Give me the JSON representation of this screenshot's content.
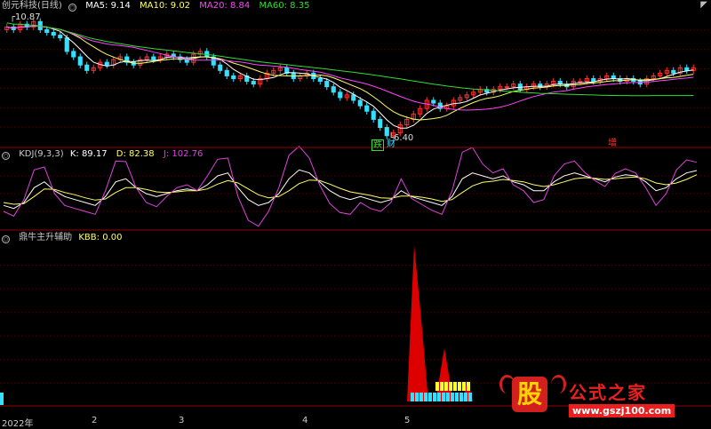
{
  "colors": {
    "ma5": "#ffffff",
    "ma10": "#ffff66",
    "ma20": "#ff44ff",
    "ma60": "#33dd33",
    "up": "#ff3333",
    "down": "#33e0ff",
    "divider": "#990000",
    "grid": "#550000",
    "k": "#ffffff",
    "d": "#ffff66",
    "j": "#dd44dd",
    "kbb_red": "#dd0000",
    "kbb_cyan": "#33e0ff",
    "kbb_yellow": "#ffff33"
  },
  "main_panel": {
    "title": "创元科技(日线)",
    "indicators": [
      {
        "label": "MA5: 9.14",
        "color": "#ffffff"
      },
      {
        "label": "MA10: 9.02",
        "color": "#ffff66"
      },
      {
        "label": "MA20: 8.84",
        "color": "#ff44ff"
      },
      {
        "label": "MA60: 8.35",
        "color": "#33dd33"
      }
    ],
    "high_mark": "10.87",
    "low_mark": "6.40",
    "tags": [
      {
        "text": "跌",
        "color": "#33dd33"
      },
      {
        "text": "财",
        "color": "#33e0ff"
      },
      {
        "text": "增",
        "color": "#ff3333"
      }
    ]
  },
  "kdj_panel": {
    "title": "KDJ(9,3,3)",
    "indicators": [
      {
        "label": "K: 89.17",
        "color": "#ffffff"
      },
      {
        "label": "D: 82.38",
        "color": "#ffff66"
      },
      {
        "label": "J: 102.76",
        "color": "#dd44dd"
      }
    ]
  },
  "kbb_panel": {
    "title": "鼎牛主升辅助",
    "indicators": [
      {
        "label": "KBB: 0.00",
        "color": "#ffff66"
      }
    ]
  },
  "time_axis": [
    "2022年",
    "2",
    "3",
    "4",
    "5"
  ],
  "watermark": {
    "badge": "股",
    "name": "公式之家",
    "url": "www.gszj100.com"
  },
  "chart_data": [
    {
      "type": "candlestick",
      "title": "创元科技(日线)",
      "series": [
        {
          "name": "MA5",
          "last": 9.14
        },
        {
          "name": "MA10",
          "last": 9.02
        },
        {
          "name": "MA20",
          "last": 8.84
        },
        {
          "name": "MA60",
          "last": 8.35
        }
      ],
      "annotations": [
        {
          "text": "10.87",
          "kind": "period-high"
        },
        {
          "text": "6.40",
          "kind": "period-low"
        }
      ],
      "close": [
        10.6,
        10.5,
        10.7,
        10.6,
        10.8,
        10.5,
        10.4,
        10.3,
        10.2,
        9.7,
        9.5,
        9.2,
        9.0,
        9.1,
        9.3,
        9.2,
        9.4,
        9.5,
        9.3,
        9.2,
        9.4,
        9.5,
        9.4,
        9.5,
        9.6,
        9.5,
        9.4,
        9.3,
        9.6,
        9.7,
        9.5,
        9.2,
        9.0,
        8.8,
        8.7,
        8.8,
        8.6,
        8.5,
        8.7,
        8.9,
        9.0,
        9.1,
        8.9,
        8.7,
        8.8,
        8.9,
        8.7,
        8.6,
        8.4,
        8.2,
        8.0,
        8.1,
        7.9,
        7.7,
        7.5,
        7.2,
        6.9,
        6.6,
        6.7,
        7.0,
        7.2,
        7.4,
        7.6,
        7.9,
        7.8,
        7.6,
        7.7,
        7.9,
        8.0,
        8.1,
        8.2,
        8.3,
        8.2,
        8.3,
        8.4,
        8.4,
        8.5,
        8.3,
        8.4,
        8.5,
        8.4,
        8.5,
        8.6,
        8.5,
        8.4,
        8.6,
        8.6,
        8.7,
        8.6,
        8.7,
        8.8,
        8.7,
        8.6,
        8.7,
        8.6,
        8.5,
        8.7,
        8.8,
        8.9,
        9.0,
        8.9,
        9.1,
        9.0,
        9.1
      ]
    },
    {
      "type": "line",
      "title": "KDJ(9,3,3)",
      "ylim": [
        -10,
        110
      ],
      "series": [
        {
          "name": "K",
          "values": [
            30,
            25,
            35,
            60,
            70,
            55,
            45,
            40,
            35,
            30,
            45,
            70,
            75,
            60,
            50,
            45,
            50,
            55,
            58,
            55,
            65,
            80,
            85,
            60,
            40,
            30,
            35,
            50,
            75,
            90,
            85,
            70,
            55,
            45,
            40,
            45,
            40,
            35,
            40,
            55,
            45,
            40,
            35,
            30,
            45,
            75,
            85,
            80,
            75,
            80,
            70,
            65,
            55,
            55,
            70,
            80,
            85,
            80,
            75,
            70,
            78,
            82,
            80,
            70,
            55,
            60,
            75,
            85,
            89
          ]
        },
        {
          "name": "D",
          "values": [
            35,
            32,
            33,
            45,
            58,
            57,
            52,
            48,
            43,
            39,
            41,
            52,
            60,
            60,
            57,
            53,
            52,
            53,
            55,
            55,
            58,
            66,
            72,
            68,
            58,
            48,
            43,
            45,
            55,
            67,
            73,
            72,
            66,
            59,
            53,
            50,
            47,
            43,
            42,
            46,
            46,
            44,
            41,
            37,
            40,
            52,
            63,
            69,
            71,
            74,
            72,
            70,
            65,
            62,
            65,
            70,
            75,
            77,
            76,
            74,
            75,
            77,
            78,
            75,
            68,
            65,
            68,
            74,
            82
          ]
        },
        {
          "name": "J",
          "values": [
            20,
            12,
            40,
            90,
            95,
            50,
            30,
            25,
            20,
            15,
            55,
            105,
            104,
            60,
            35,
            28,
            45,
            60,
            65,
            55,
            80,
            108,
            110,
            45,
            5,
            -5,
            20,
            60,
            115,
            130,
            110,
            65,
            33,
            18,
            15,
            35,
            25,
            20,
            35,
            75,
            42,
            32,
            22,
            15,
            55,
            120,
            128,
            100,
            85,
            92,
            65,
            55,
            35,
            40,
            80,
            100,
            105,
            86,
            72,
            62,
            84,
            92,
            85,
            60,
            30,
            50,
            90,
            107,
            103
          ]
        }
      ]
    },
    {
      "type": "area",
      "title": "鼎牛主升辅助",
      "series": [
        {
          "name": "KBB",
          "last": 0.0
        }
      ]
    }
  ]
}
